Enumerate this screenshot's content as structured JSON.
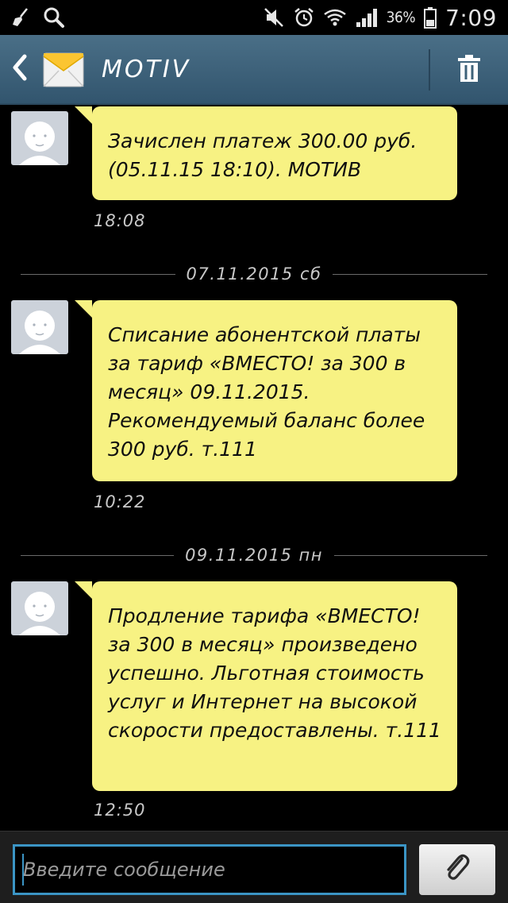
{
  "status_bar": {
    "battery_percent": "36%",
    "time": "7:09",
    "icons": [
      "broom-icon",
      "search-icon",
      "mute-icon",
      "alarm-icon",
      "wifi-icon",
      "signal-icon",
      "battery-icon"
    ]
  },
  "header": {
    "contact_name": "MOTIV",
    "icons": [
      "back-arrow-icon",
      "envelope-icon",
      "trash-icon"
    ]
  },
  "messages": [
    {
      "text": "Зачислен платеж 300.00 руб. (05.11.15 18:10). МОТИВ",
      "time": "18:08"
    },
    {
      "text": "Списание абонентской платы за тариф «ВМЕСТО! за 300 в месяц» 09.11.2015. Рекомендуемый баланс более 300 руб. т.111",
      "time": "10:22"
    },
    {
      "text": "Продление тарифа «ВМЕСТО! за 300 в месяц» произведено успешно. Льготная стоимость услуг и Интернет на высокой скорости предоставлены. т.111",
      "time": "12:50"
    }
  ],
  "date_separators": [
    "07.11.2015 сб",
    "09.11.2015 пн"
  ],
  "compose": {
    "placeholder": "Введите сообщение"
  },
  "colors": {
    "bubble": "#f7f283",
    "action_bar": "#3e6279",
    "input_border": "#3b95c5"
  }
}
